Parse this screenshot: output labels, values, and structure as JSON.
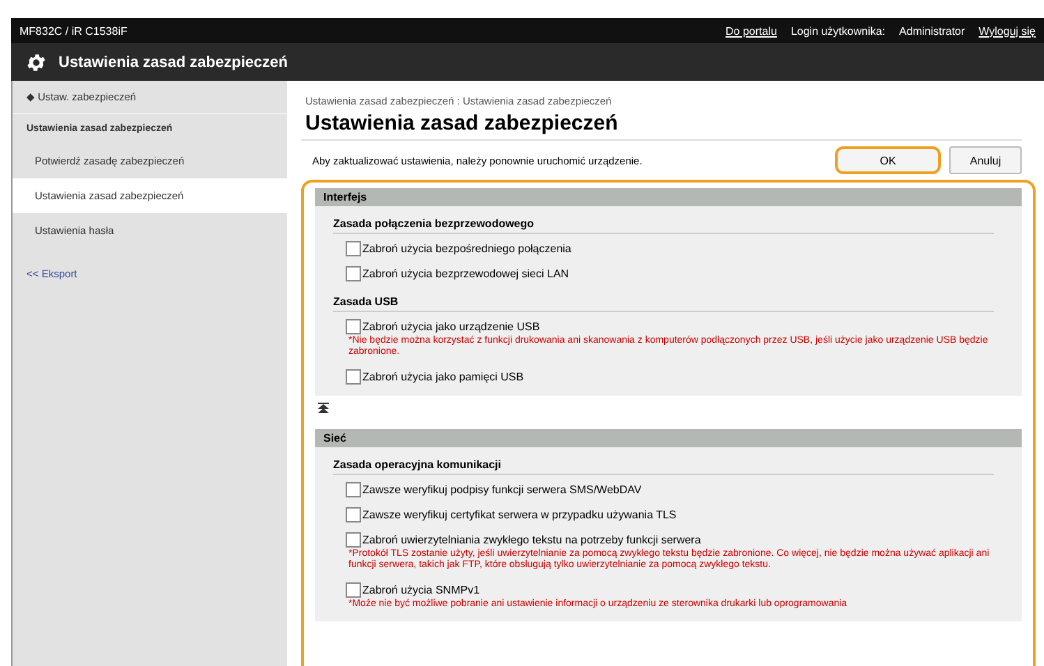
{
  "top_bar": {
    "device": "MF832C / iR C1538iF",
    "links": [
      "Do portalu",
      "Login użytkownika:",
      "Administrator",
      "Wyloguj się"
    ]
  },
  "title_bar": {
    "title": "Ustawienia zasad zabezpieczeń"
  },
  "sidebar": {
    "back": "◆ Ustaw. zabezpieczeń",
    "group": "Ustawienia zasad zabezpieczeń",
    "items": [
      {
        "label": "Potwierdź zasadę zabezpieczeń",
        "selected": false
      },
      {
        "label": "Ustawienia zasad zabezpieczeń",
        "selected": true
      },
      {
        "label": "Ustawienia hasła",
        "selected": false
      }
    ],
    "export": "<< Eksport"
  },
  "main": {
    "breadcrumb": "Ustawienia zasad zabezpieczeń : Ustawienia zasad zabezpieczeń",
    "heading": "Ustawienia zasad zabezpieczeń",
    "message": "Aby zaktualizować ustawienia, należy ponownie uruchomić urządzenie.",
    "buttons": [
      {
        "label": "OK",
        "highlighted": true
      },
      {
        "label": "Anuluj",
        "highlighted": false
      }
    ],
    "panel_highlighted": true,
    "sections": [
      {
        "title": "Interfejs",
        "groups": [
          {
            "title": "Zasada połączenia bezprzewodowego",
            "options": [
              {
                "label": "Zabroń użycia bezpośredniego połączenia",
                "checked": false
              },
              {
                "label": "Zabroń użycia bezprzewodowej sieci LAN",
                "checked": false
              }
            ]
          },
          {
            "title": "Zasada USB",
            "options": [
              {
                "label": "Zabroń użycia jako urządzenie USB",
                "checked": false,
                "note": "*Nie będzie można korzystać z funkcji drukowania ani skanowania z komputerów podłączonych przez USB, jeśli użycie jako urządzenie USB będzie zabronione."
              },
              {
                "label": "Zabroń użycia jako pamięci USB",
                "checked": false
              }
            ]
          }
        ],
        "to_top": true
      },
      {
        "title": "Sieć",
        "groups": [
          {
            "title": "Zasada operacyjna komunikacji",
            "options": [
              {
                "label": "Zawsze weryfikuj podpisy funkcji serwera SMS/WebDAV",
                "checked": false
              },
              {
                "label": "Zawsze weryfikuj certyfikat serwera w przypadku używania TLS",
                "checked": false
              },
              {
                "label": "Zabroń uwierzytelniania zwykłego tekstu na potrzeby funkcji serwera",
                "checked": false,
                "note": "*Protokół TLS zostanie użyty, jeśli uwierzytelnianie za pomocą zwykłego tekstu będzie zabronione. Co więcej, nie będzie można używać aplikacji ani funkcji serwera, takich jak FTP, które obsługują tylko uwierzytelnianie za pomocą zwykłego tekstu."
              },
              {
                "label": "Zabroń użycia SNMPv1",
                "checked": false,
                "note": "*Może nie być możliwe pobranie ani ustawienie informacji o urządzeniu ze sterownika drukarki lub oprogramowania"
              }
            ]
          }
        ],
        "to_top": false
      }
    ]
  }
}
